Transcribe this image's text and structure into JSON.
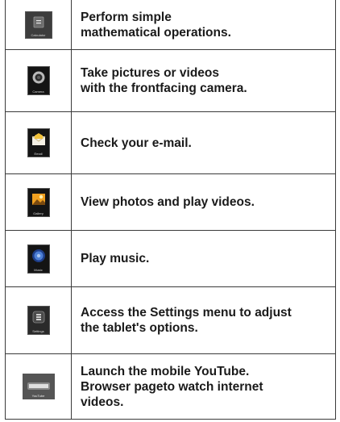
{
  "rows": [
    {
      "icon": "calculator-icon",
      "caption": "Calculator",
      "text": "Perform simple\nmathematical operations."
    },
    {
      "icon": "camera-icon",
      "caption": "Camera",
      "text": "Take pictures or videos\nwith the frontfacing camera."
    },
    {
      "icon": "email-icon",
      "caption": "Email",
      "text": "Check your e-mail."
    },
    {
      "icon": "gallery-icon",
      "caption": "Gallery",
      "text": "View photos and play videos."
    },
    {
      "icon": "music-icon",
      "caption": "Music",
      "text": "Play music."
    },
    {
      "icon": "settings-icon",
      "caption": "Settings",
      "text": "Access the Settings menu to adjust\nthe tablet's options."
    },
    {
      "icon": "youtube-icon",
      "caption": "YouTube",
      "text": "Launch the mobile YouTube.\nBrowser pageto watch internet\nvideos."
    }
  ]
}
